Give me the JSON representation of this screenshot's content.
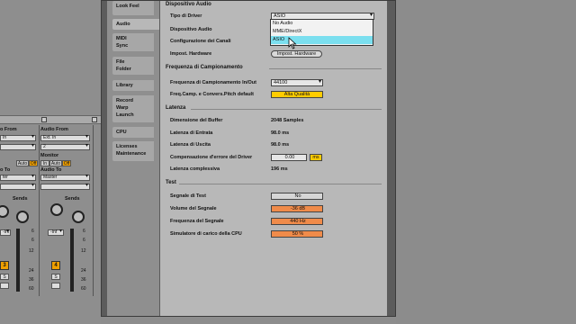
{
  "mixer": {
    "audio_from_label": "Audio From",
    "audio_from_label_2": "o From",
    "input_left": "In",
    "input_right": "Ext. In",
    "channel_right": "2",
    "monitor_label": "Monitor",
    "monitor_in": "In",
    "monitor_auto": "Auto",
    "monitor_off": "Off",
    "audio_to_label": "Audio To",
    "audio_to_label_2": "o To",
    "out_left": "ter",
    "out_right": "Master",
    "sends_label": "Sends",
    "knob_a": "A",
    "knob_b": "B",
    "fader_left": "-Inf",
    "fader_right": "-Inf",
    "track_left": "3",
    "track_right": "4",
    "solo": "S",
    "ticks": [
      "6",
      "12",
      "24",
      "36",
      "60"
    ],
    "ticks_top": [
      "6",
      "0"
    ]
  },
  "tabs": [
    {
      "label": "Look\nFeel"
    },
    {
      "label": "Audio",
      "active": true
    },
    {
      "label": "MIDI\nSync"
    },
    {
      "label": "File\nFolder"
    },
    {
      "label": "Library"
    },
    {
      "label": "Record\nWarp\nLaunch"
    },
    {
      "label": "CPU"
    },
    {
      "label": "Licenses\nMaintenance"
    }
  ],
  "audio_device": {
    "section": "Dispositivo Audio",
    "driver_type_label": "Tipo di Driver",
    "driver_type_value": "ASIO",
    "device_label": "Dispositivo Audio",
    "channels_label": "Configurazione dei Canali",
    "hardware_label": "Impost. Hardware",
    "hardware_button": "Impost. Hardware",
    "dropdown_options": [
      "No Audio",
      "MME/DirectX",
      "ASIO"
    ],
    "dropdown_selected": "ASIO"
  },
  "sample_rate": {
    "section": "Frequenza di Campionamento",
    "rate_label": "Frequenza di Campionamento In/Out",
    "rate_value": "44100",
    "conv_label": "Freq.Camp. e Convers.Pitch default",
    "conv_value": "Alta Qualità"
  },
  "latency": {
    "section": "Latenza",
    "buffer_label": "Dimensione del Buffer",
    "buffer_value": "2048 Samples",
    "in_label": "Latenza di Entrata",
    "in_value": "98.0 ms",
    "out_label": "Latenza di Uscita",
    "out_value": "98.0 ms",
    "comp_label": "Compensazione d'errore del Driver",
    "comp_value": "0.00",
    "comp_unit": "ms",
    "total_label": "Latenza complessiva",
    "total_value": "196 ms"
  },
  "test": {
    "section": "Test",
    "signal_label": "Segnale di Test",
    "signal_value": "No",
    "volume_label": "Volume del Segnale",
    "volume_value": "-36",
    "volume_unit": "dB",
    "freq_label": "Frequenza del Segnale",
    "freq_value": "440",
    "freq_unit": "Hz",
    "cpu_label": "Simulatore di carico della CPU",
    "cpu_value": "50",
    "cpu_unit": "%"
  },
  "colors": {
    "orange_field": "#f08b4a",
    "yellow_button": "#ffcc00",
    "dropdown_highlight": "#7bdfef"
  }
}
